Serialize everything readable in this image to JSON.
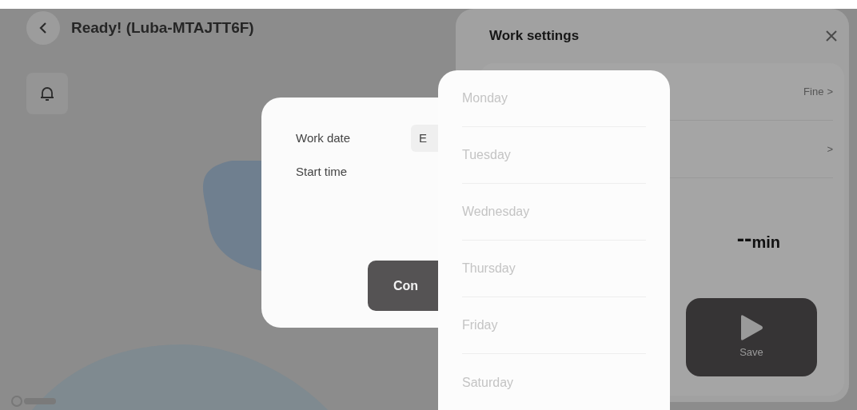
{
  "header": {
    "title": "Ready! (Luba-MTAJTT6F)"
  },
  "settings_panel": {
    "title": "Work settings",
    "rows": [
      {
        "value": "Fine",
        "chevron": ">"
      },
      {
        "chevron": ">"
      }
    ],
    "duration": {
      "value": "--",
      "unit": "min"
    },
    "save_button": "Save"
  },
  "dialog": {
    "fields": [
      {
        "label": "Work date",
        "value": "E"
      },
      {
        "label": "Start time"
      }
    ],
    "button": "Con"
  },
  "day_list": [
    {
      "label": "Monday",
      "disabled": true
    },
    {
      "label": "Tuesday",
      "disabled": true
    },
    {
      "label": "Wednesday",
      "disabled": true
    },
    {
      "label": "Thursday",
      "disabled": true
    },
    {
      "label": "Friday",
      "disabled": true
    },
    {
      "label": "Saturday",
      "disabled": true
    }
  ]
}
